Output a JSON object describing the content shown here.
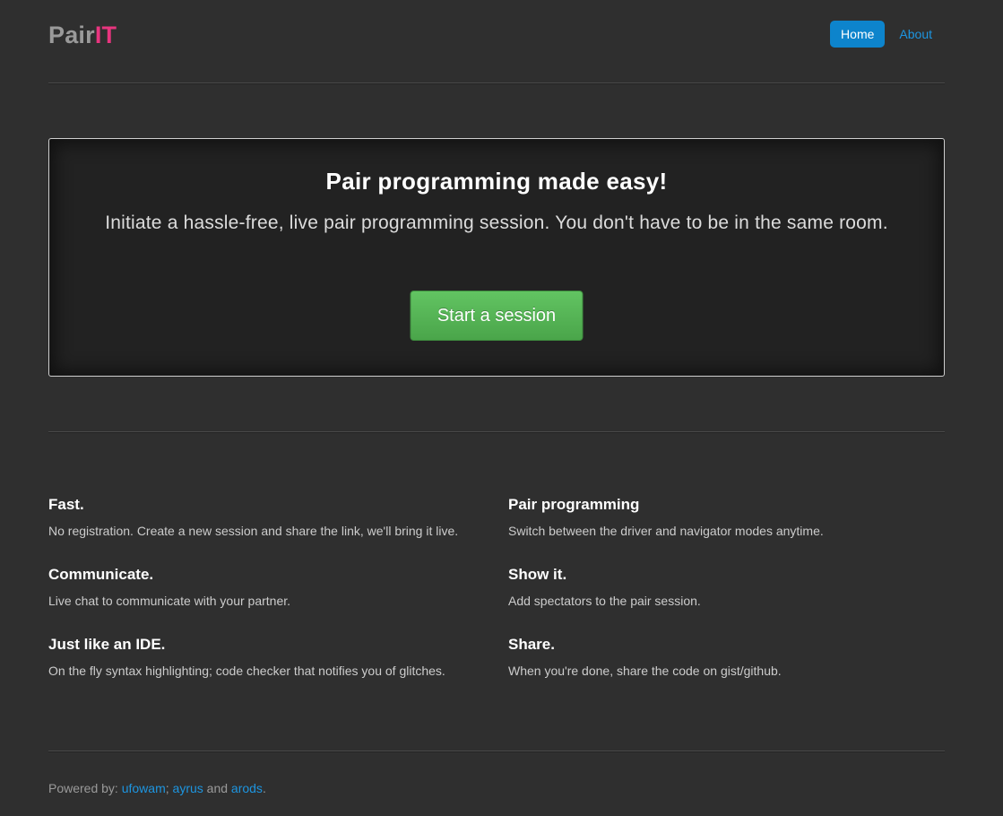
{
  "brand": {
    "part1": "Pair",
    "part2": "IT"
  },
  "nav": {
    "home": "Home",
    "about": "About"
  },
  "hero": {
    "title": "Pair programming made easy!",
    "subtitle": "Initiate a hassle-free, live pair programming session. You don't have to be in the same room.",
    "button": "Start a session"
  },
  "features": [
    {
      "title": "Fast.",
      "desc": "No registration. Create a new session and share the link, we'll bring it live."
    },
    {
      "title": "Pair programming",
      "desc": "Switch between the driver and navigator modes anytime."
    },
    {
      "title": "Communicate.",
      "desc": "Live chat to communicate with your partner."
    },
    {
      "title": "Show it.",
      "desc": "Add spectators to the pair session."
    },
    {
      "title": "Just like an IDE.",
      "desc": "On the fly syntax highlighting; code checker that notifies you of glitches."
    },
    {
      "title": "Share.",
      "desc": "When you're done, share the code on gist/github."
    }
  ],
  "footer": {
    "prefix": "Powered by: ",
    "author1": "ufowam",
    "sep1": "; ",
    "author2": "ayrus",
    "sep2": " and ",
    "author3": "arods",
    "suffix": "."
  },
  "colors": {
    "accent": "#0d84cc",
    "brand_pink": "#e8357f",
    "button_green": "#5bb75b"
  }
}
